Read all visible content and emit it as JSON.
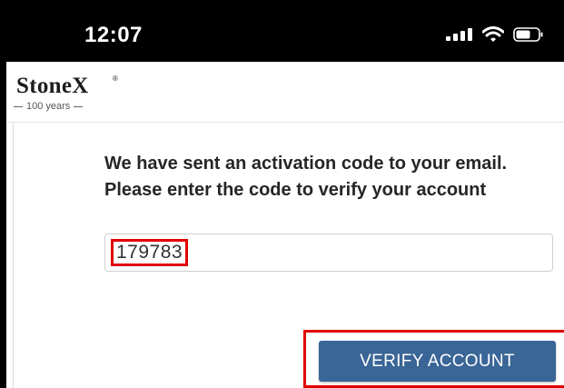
{
  "status_bar": {
    "time": "12:07",
    "icons": [
      "signal-icon",
      "wifi-icon",
      "battery-icon"
    ]
  },
  "header": {
    "logo_text": "StoneX",
    "logo_mark": "®",
    "logo_tagline": "100 years"
  },
  "main": {
    "message": "We have sent an activation code to your email. Please enter the code to verify your account",
    "code_input": {
      "value": "179783"
    },
    "verify_button_label": "VERIFY ACCOUNT"
  },
  "colors": {
    "status_bar_bg": "#000000",
    "button_bg": "#3a6597",
    "highlight": "#e00000",
    "text": "#262626"
  }
}
